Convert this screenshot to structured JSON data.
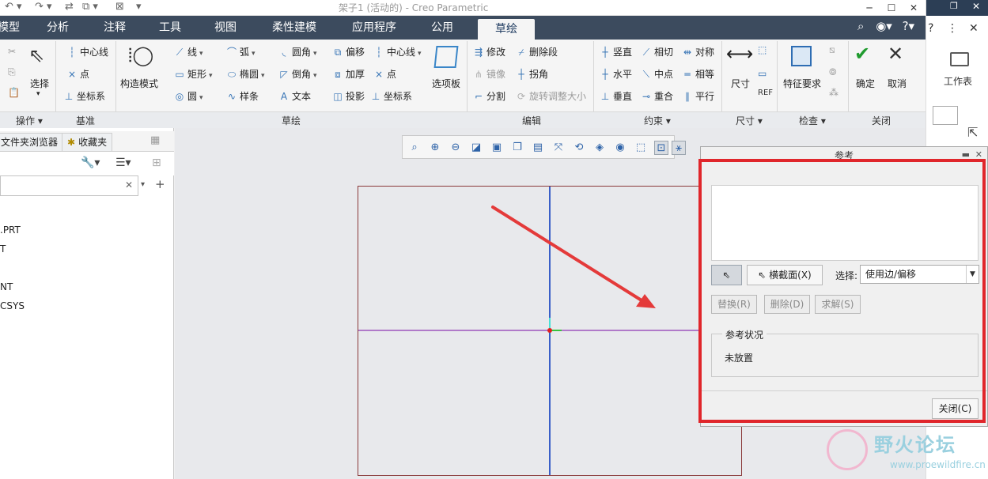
{
  "window": {
    "title": "架子1 (活动的) - Creo Parametric"
  },
  "tabs": [
    {
      "label": "模型"
    },
    {
      "label": "分析"
    },
    {
      "label": "注释"
    },
    {
      "label": "工具"
    },
    {
      "label": "视图"
    },
    {
      "label": "柔性建模"
    },
    {
      "label": "应用程序"
    },
    {
      "label": "公用"
    },
    {
      "label": "草绘",
      "active": true
    }
  ],
  "ribbon": {
    "operations": {
      "select_label": "选择",
      "group_label": "操作"
    },
    "datum": {
      "centerline": "中心线",
      "point": "点",
      "csys": "坐标系",
      "group_label": "基准"
    },
    "construction_mode": "构造模式",
    "sketch": {
      "line": "线",
      "arc": "弧",
      "fillet": "圆角",
      "offset": "偏移",
      "centerline": "中心线",
      "rectangle": "矩形",
      "ellipse": "椭圆",
      "chamfer": "倒角",
      "thicken": "加厚",
      "point": "点",
      "circle": "圆",
      "spline": "样条",
      "text": "文本",
      "project": "投影",
      "csys": "坐标系",
      "palette": "选项板",
      "group_label": "草绘"
    },
    "edit": {
      "modify": "修改",
      "delete_segment": "删除段",
      "mirror": "镜像",
      "corner": "拐角",
      "divide": "分割",
      "rotate_resize": "旋转调整大小",
      "group_label": "编辑"
    },
    "constrain": {
      "vertical": "竖直",
      "tangent": "相切",
      "symmetric": "对称",
      "horizontal": "水平",
      "midpoint": "中点",
      "equal": "相等",
      "perpendicular": "垂直",
      "coincident": "重合",
      "parallel": "平行",
      "group_label": "约束"
    },
    "dimension": {
      "label": "尺寸",
      "group_label": "尺寸"
    },
    "inspect": {
      "feature_req": "特征要求",
      "group_label": "检查"
    },
    "close": {
      "ok": "确定",
      "cancel": "取消",
      "group_label": "关闭"
    }
  },
  "navigator": {
    "tabs": [
      "文件夹浏览器",
      "收藏夹"
    ],
    "tree": [
      ".PRT",
      "T",
      "NT",
      "CSYS"
    ]
  },
  "right_panel": {
    "workbench_label": "工作表"
  },
  "references_dialog": {
    "title": "参考",
    "cross_section_btn": "横截面(X)",
    "select_label": "选择:",
    "select_value": "使用边/偏移",
    "replace_btn": "替换(R)",
    "delete_btn": "删除(D)",
    "solve_btn": "求解(S)",
    "status_group_label": "参考状况",
    "status_value": "未放置",
    "close_btn": "关闭(C)"
  },
  "watermark": {
    "name": "野火论坛",
    "url": "www.proewildfire.cn"
  },
  "colors": {
    "accent": "#3c4b5e",
    "highlight": "#e0262b",
    "arrow": "#e43a3a"
  }
}
